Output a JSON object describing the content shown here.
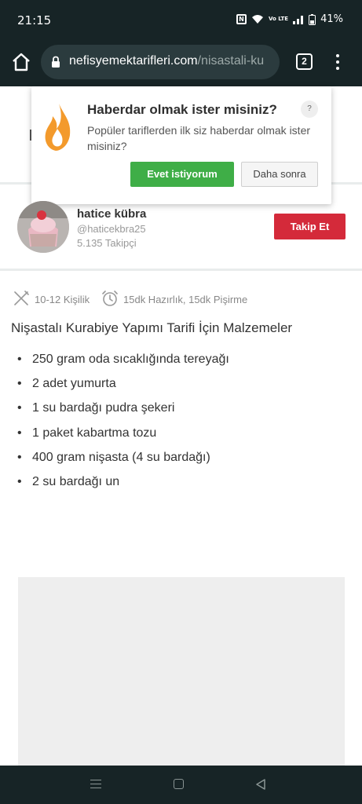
{
  "status": {
    "time": "21:15",
    "battery": "41%",
    "nfc": "N",
    "volte": "Vo LTE"
  },
  "browser": {
    "url_domain": "nefisyemektarifleri.com",
    "url_path": "/nisastali-ku",
    "tab_count": "2"
  },
  "notification": {
    "title": "Haberdar olmak ister misiniz?",
    "help": "?",
    "message": "Popüler tariflerden ilk siz haberdar olmak ister misiniz?",
    "accept_label": "Evet istiyorum",
    "later_label": "Daha sonra",
    "accept_color": "#3fae47"
  },
  "author": {
    "name": "hatice kübra",
    "handle": "@haticekbra25",
    "followers": "5.135 Takipçi",
    "follow_label": "Takip Et",
    "follow_color": "#d42a3a"
  },
  "recipe": {
    "servings": "10-12 Kişilik",
    "time": "15dk Hazırlık, 15dk Pişirme",
    "ingredients_title": "Nişastalı Kurabiye Yapımı Tarifi İçin Malzemeler",
    "ingredients": [
      "250 gram oda sıcaklığında tereyağı",
      "2 adet yumurta",
      "1 su bardağı pudra şekeri",
      "1 paket kabartma tozu",
      "400 gram nişasta (4 su bardağı)",
      "2 su bardağı un"
    ]
  },
  "icons": {
    "servings": "fork-knife-icon",
    "time": "alarm-clock-icon",
    "flame": "flame-icon"
  }
}
